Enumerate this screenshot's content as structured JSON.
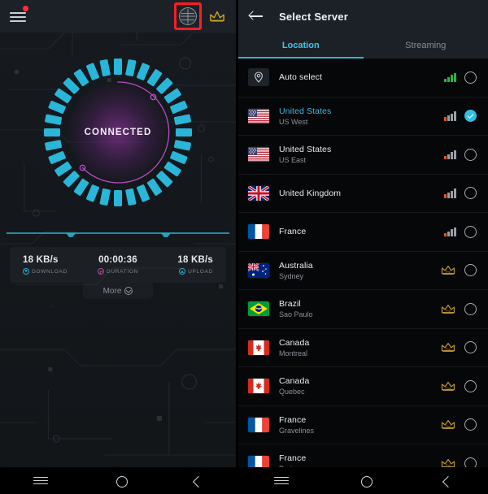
{
  "left_panel": {
    "topbar": {
      "menu_icon": "hamburger-menu-icon",
      "notification_dot": true,
      "globe_icon": "globe-icon",
      "crown_icon": "crown-icon",
      "highlight_color": "#ff1d25"
    },
    "dial": {
      "status_label": "CONNECTED",
      "segment_color": "#29b6d8",
      "arc_color": "#b84cc4",
      "segment_count": 32
    },
    "stats": [
      {
        "value": "18 KB/s",
        "label": "DOWNLOAD",
        "icon": "download-icon",
        "color": "#29a8d8"
      },
      {
        "value": "00:00:36",
        "label": "DURATION",
        "icon": "clock-icon",
        "color": "#b8459f"
      },
      {
        "value": "18 KB/s",
        "label": "UPLOAD",
        "icon": "upload-icon",
        "color": "#29a8d8"
      }
    ],
    "more_label": "More",
    "more_icon": "chevron-down-circle-icon"
  },
  "right_panel": {
    "topbar": {
      "back_icon": "back-arrow-icon",
      "title": "Select Server"
    },
    "tabs": [
      {
        "label": "Location",
        "active": true
      },
      {
        "label": "Streaming",
        "active": false
      }
    ],
    "accent_color": "#29b6d8",
    "servers": [
      {
        "title": "Auto select",
        "subtitle": "",
        "flag": "auto",
        "indicator": "bars",
        "signal": 4,
        "signal_color": "#27b24a",
        "selected": false
      },
      {
        "title": "United States",
        "subtitle": "US West",
        "flag": "us",
        "indicator": "bars",
        "signal": 1,
        "signal_color": "#e8531f",
        "selected": true
      },
      {
        "title": "United States",
        "subtitle": "US East",
        "flag": "us",
        "indicator": "bars",
        "signal": 1,
        "signal_color": "#e8531f",
        "selected": false
      },
      {
        "title": "United Kingdom",
        "subtitle": "",
        "flag": "uk",
        "indicator": "bars",
        "signal": 1,
        "signal_color": "#e8531f",
        "selected": false
      },
      {
        "title": "France",
        "subtitle": "",
        "flag": "fr",
        "indicator": "bars",
        "signal": 1,
        "signal_color": "#e8531f",
        "selected": false
      },
      {
        "title": "Australia",
        "subtitle": "Sydney",
        "flag": "au",
        "indicator": "pro",
        "pro_label": "Pro",
        "selected": false
      },
      {
        "title": "Brazil",
        "subtitle": "Sao Paulo",
        "flag": "br",
        "indicator": "pro",
        "pro_label": "Pro",
        "selected": false
      },
      {
        "title": "Canada",
        "subtitle": "Montreal",
        "flag": "ca",
        "indicator": "pro",
        "pro_label": "Pro",
        "selected": false
      },
      {
        "title": "Canada",
        "subtitle": "Quebec",
        "flag": "ca",
        "indicator": "pro",
        "pro_label": "Pro",
        "selected": false
      },
      {
        "title": "France",
        "subtitle": "Gravelines",
        "flag": "fr",
        "indicator": "pro",
        "pro_label": "Pro",
        "selected": false
      },
      {
        "title": "France",
        "subtitle": "Paris",
        "flag": "fr",
        "indicator": "pro",
        "pro_label": "Pro",
        "selected": false
      }
    ]
  },
  "navbar": {
    "recent_icon": "recent-apps-icon",
    "home_icon": "home-icon",
    "back_icon": "back-icon"
  }
}
